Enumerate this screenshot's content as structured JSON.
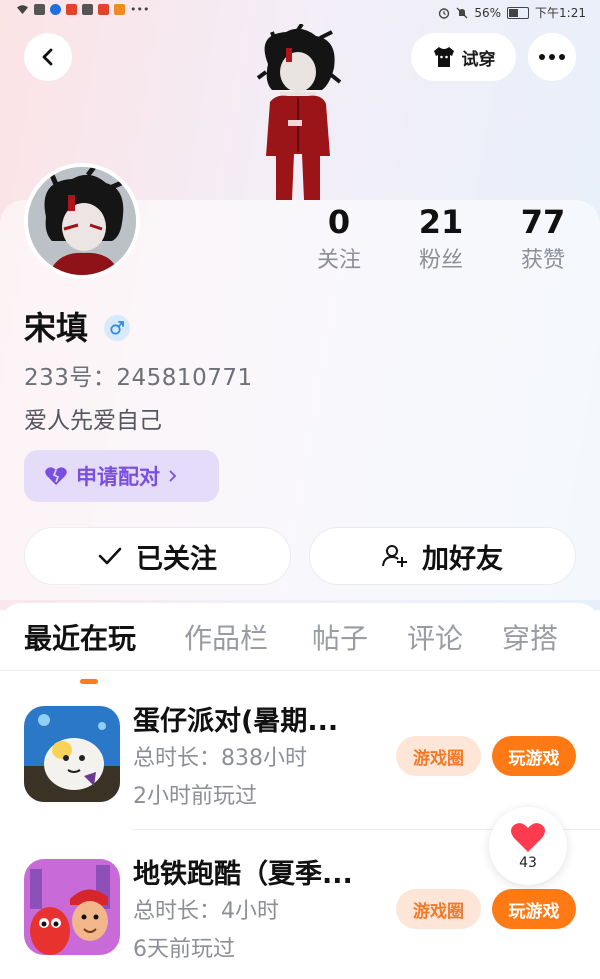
{
  "status_bar": {
    "battery": "56%",
    "time": "下午1:21",
    "battery_level": 0.56
  },
  "header": {
    "tryon_label": "试穿",
    "icons": {
      "back": "back-arrow-icon",
      "more": "more-dots-icon",
      "tryon": "shirt-icon"
    }
  },
  "profile": {
    "name": "宋填",
    "gender": "male",
    "id_text": "233号：245810771",
    "bio": "爱人先爱自己",
    "pair_button": "申请配对",
    "stats": [
      {
        "value": "0",
        "label": "关注"
      },
      {
        "value": "21",
        "label": "粉丝"
      },
      {
        "value": "77",
        "label": "获赞"
      }
    ]
  },
  "actions": {
    "followed": "已关注",
    "add_friend": "加好友"
  },
  "tabs": [
    {
      "label": "最近在玩",
      "active": true
    },
    {
      "label": "作品栏",
      "active": false
    },
    {
      "label": "帖子",
      "active": false
    },
    {
      "label": "评论",
      "active": false
    },
    {
      "label": "穿搭",
      "active": false
    }
  ],
  "games": [
    {
      "title": "蛋仔派对(暑期...",
      "playtime": "总时长：838小时",
      "last_played": "2小时前玩过",
      "circle_label": "游戏圈",
      "play_label": "玩游戏"
    },
    {
      "title": "地铁跑酷（夏季...",
      "playtime": "总时长：4小时",
      "last_played": "6天前玩过",
      "circle_label": "游戏圈",
      "play_label": "玩游戏"
    }
  ],
  "like_fab": {
    "count": "43"
  },
  "colors": {
    "accent_orange": "#ff7a14",
    "pair_purple": "#7a4fe0",
    "like_red": "#ff3b4f"
  }
}
